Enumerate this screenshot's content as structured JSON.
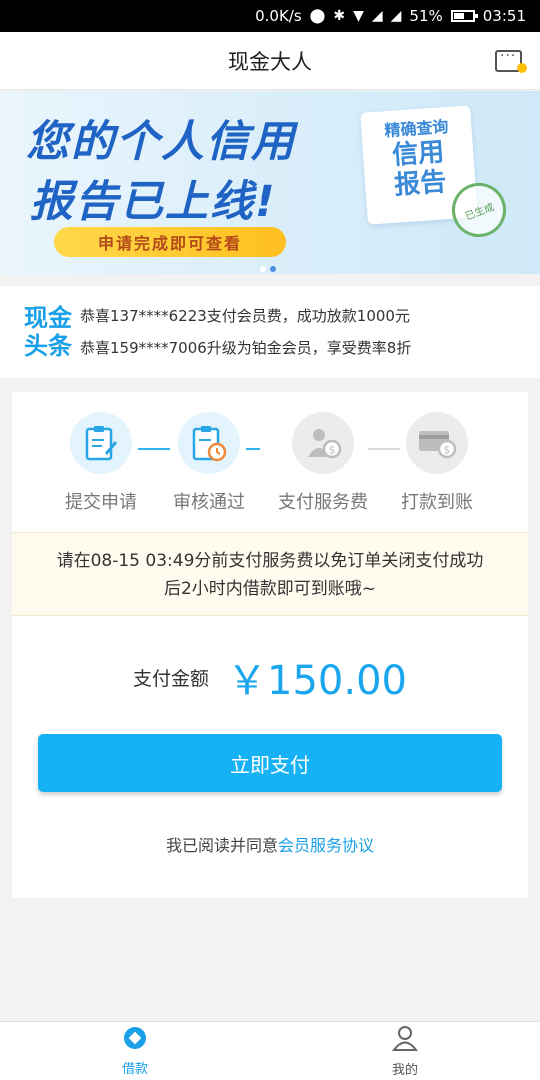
{
  "status_bar": {
    "speed": "0.0K/s",
    "battery": "51%",
    "time": "03:51"
  },
  "header": {
    "title": "现金大人"
  },
  "banner": {
    "line1": "您的个人信用",
    "line2": "报告已上线!",
    "button": "申请完成即可查看",
    "report_small": "精确查询",
    "report_big1": "信用",
    "report_big2": "报告",
    "stamp": "已生成"
  },
  "headlines": {
    "logo_line1": "现金",
    "logo_line2": "头条",
    "items": [
      "恭喜137****6223支付会员费，成功放款1000元",
      "恭喜159****7006升级为铂金会员，享受费率8折"
    ]
  },
  "steps": [
    {
      "label": "提交申请",
      "state": "done"
    },
    {
      "label": "审核通过",
      "state": "done"
    },
    {
      "label": "支付服务费",
      "state": "pending"
    },
    {
      "label": "打款到账",
      "state": "pending"
    }
  ],
  "notice": {
    "line1": "请在08-15 03:49分前支付服务费以免订单关闭支付成功",
    "line2": "后2小时内借款即可到账哦~"
  },
  "payment": {
    "label": "支付金额",
    "amount": "￥150.00",
    "button": "立即支付",
    "agree_prefix": "我已阅读并同意",
    "agree_link": "会员服务协议"
  },
  "bottom_nav": [
    {
      "label": "借款",
      "active": true
    },
    {
      "label": "我的",
      "active": false
    }
  ],
  "colors": {
    "accent": "#17b2f6",
    "link": "#1aa0e8",
    "notice_bg": "#fffbef"
  }
}
